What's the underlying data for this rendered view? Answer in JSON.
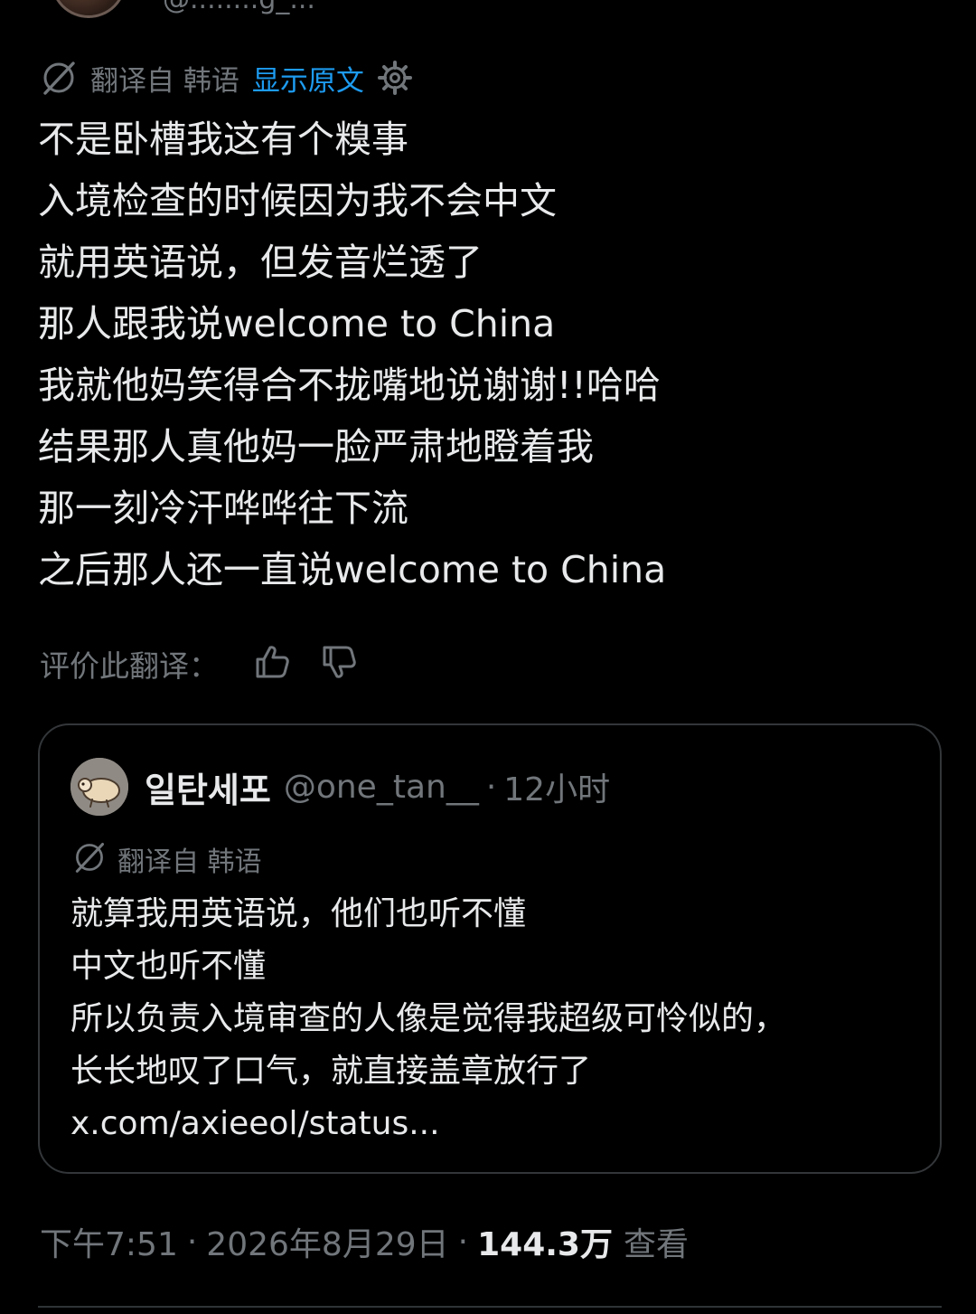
{
  "author": {
    "handle_partial": "@........g_..."
  },
  "translation": {
    "label": "翻译自 韩语",
    "show_original": "显示原文"
  },
  "post": {
    "lines": [
      "不是卧槽我这有个糗事",
      "入境检查的时候因为我不会中文",
      "就用英语说，但发音烂透了",
      "那人跟我说welcome to China",
      "我就他妈笑得合不拢嘴地说谢谢!!哈哈",
      "结果那人真他妈一脸严肃地瞪着我",
      "那一刻冷汗哗哗往下流",
      "之后那人还一直说welcome to China"
    ]
  },
  "rate": {
    "label": "评价此翻译："
  },
  "quote": {
    "name": "일탄세포",
    "handle": "@one_tan__",
    "separator": "·",
    "time": "12小时",
    "translation_label": "翻译自 韩语",
    "lines": [
      "就算我用英语说，他们也听不懂",
      "中文也听不懂",
      "所以负责入境审查的人像是觉得我超级可怜似的，",
      "长长地叹了口气，就直接盖章放行了",
      "x.com/axieeol/status..."
    ]
  },
  "meta": {
    "time": "下午7:51",
    "separator": "·",
    "date": "2026年8月29日",
    "views": "144.3万",
    "views_label": "查看"
  },
  "colors": {
    "background": "#000000",
    "text": "#e7e9ea",
    "muted": "#71767b",
    "link": "#1d9bf0",
    "border": "#333639"
  },
  "icons": {
    "translate": "translate-slash-icon",
    "settings": "gear-icon",
    "thumbs_up": "thumbs-up-icon",
    "thumbs_down": "thumbs-down-icon"
  }
}
